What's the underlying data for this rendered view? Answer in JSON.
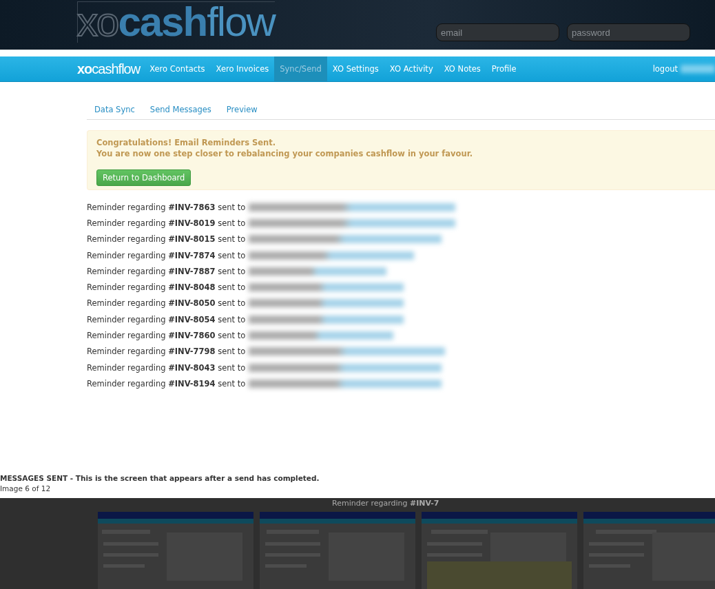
{
  "site_header": {
    "logo": {
      "prefix": "xo",
      "main": "cash",
      "suffix": "flow"
    },
    "email_placeholder": "email",
    "password_placeholder": "password"
  },
  "nav": {
    "logo": {
      "prefix": "xo",
      "main": "cash",
      "suffix": "flow"
    },
    "items": [
      {
        "label": "Xero Contacts",
        "selected": false
      },
      {
        "label": "Xero Invoices",
        "selected": false
      },
      {
        "label": "Sync/Send",
        "selected": true
      },
      {
        "label": "XO Settings",
        "selected": false
      },
      {
        "label": "XO Activity",
        "selected": false
      },
      {
        "label": "XO Notes",
        "selected": false
      },
      {
        "label": "Profile",
        "selected": false
      }
    ],
    "logout": "logout"
  },
  "subtabs": [
    "Data Sync",
    "Send Messages",
    "Preview"
  ],
  "alert": {
    "title": "Congratulations! Email Reminders Sent.",
    "message": "You are now one step closer to rebalancing your companies cashflow in your favour.",
    "button": "Return to Dashboard"
  },
  "reminders": [
    {
      "text": "Reminder regarding **#INV-7863** sent to"
    },
    {
      "text": "Reminder regarding **#INV-8019** sent to"
    },
    {
      "text": "Reminder regarding **#INV-8015** sent to"
    },
    {
      "text": "Reminder regarding **#INV-7874** sent to"
    },
    {
      "text": "Reminder regarding **#INV-7887** sent to"
    },
    {
      "text": "Reminder regarding **#INV-8048** sent to"
    },
    {
      "text": "Reminder regarding **#INV-8050** sent to"
    },
    {
      "text": "Reminder regarding **#INV-8054** sent to"
    },
    {
      "text": "Reminder regarding **#INV-7860** sent to"
    },
    {
      "text": "Reminder regarding **#INV-7798** sent to"
    },
    {
      "text": "Reminder regarding **#INV-8043** sent to"
    },
    {
      "text": "Reminder regarding **#INV-8194** sent to"
    }
  ],
  "caption": {
    "title": "MESSAGES SENT - This is the screen that appears after a send has completed.",
    "counter": "Image 6 of 12"
  },
  "gallery": {
    "behind_text": "Reminder regarding **#INV-7**"
  }
}
